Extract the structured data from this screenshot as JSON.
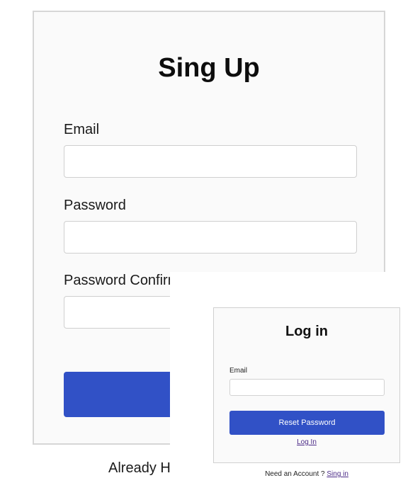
{
  "signup": {
    "title": "Sing Up",
    "email_label": "Email",
    "password_label": "Password",
    "password_confirm_label": "Password Confirm",
    "email_value": "",
    "password_value": "",
    "password_confirm_value": "",
    "submit_label": "",
    "footer_text": "Already H"
  },
  "login": {
    "title": "Log in",
    "email_label": "Email",
    "email_value": "",
    "reset_button_label": "Reset Password",
    "login_link_label": "Log In",
    "need_account_text": "Need an Account ? ",
    "sign_in_link_label": "Sing in"
  },
  "colors": {
    "accent": "#3151c6",
    "link": "#4b2a87",
    "card_background": "#fafafa",
    "card_border": "#d6d6d6"
  }
}
